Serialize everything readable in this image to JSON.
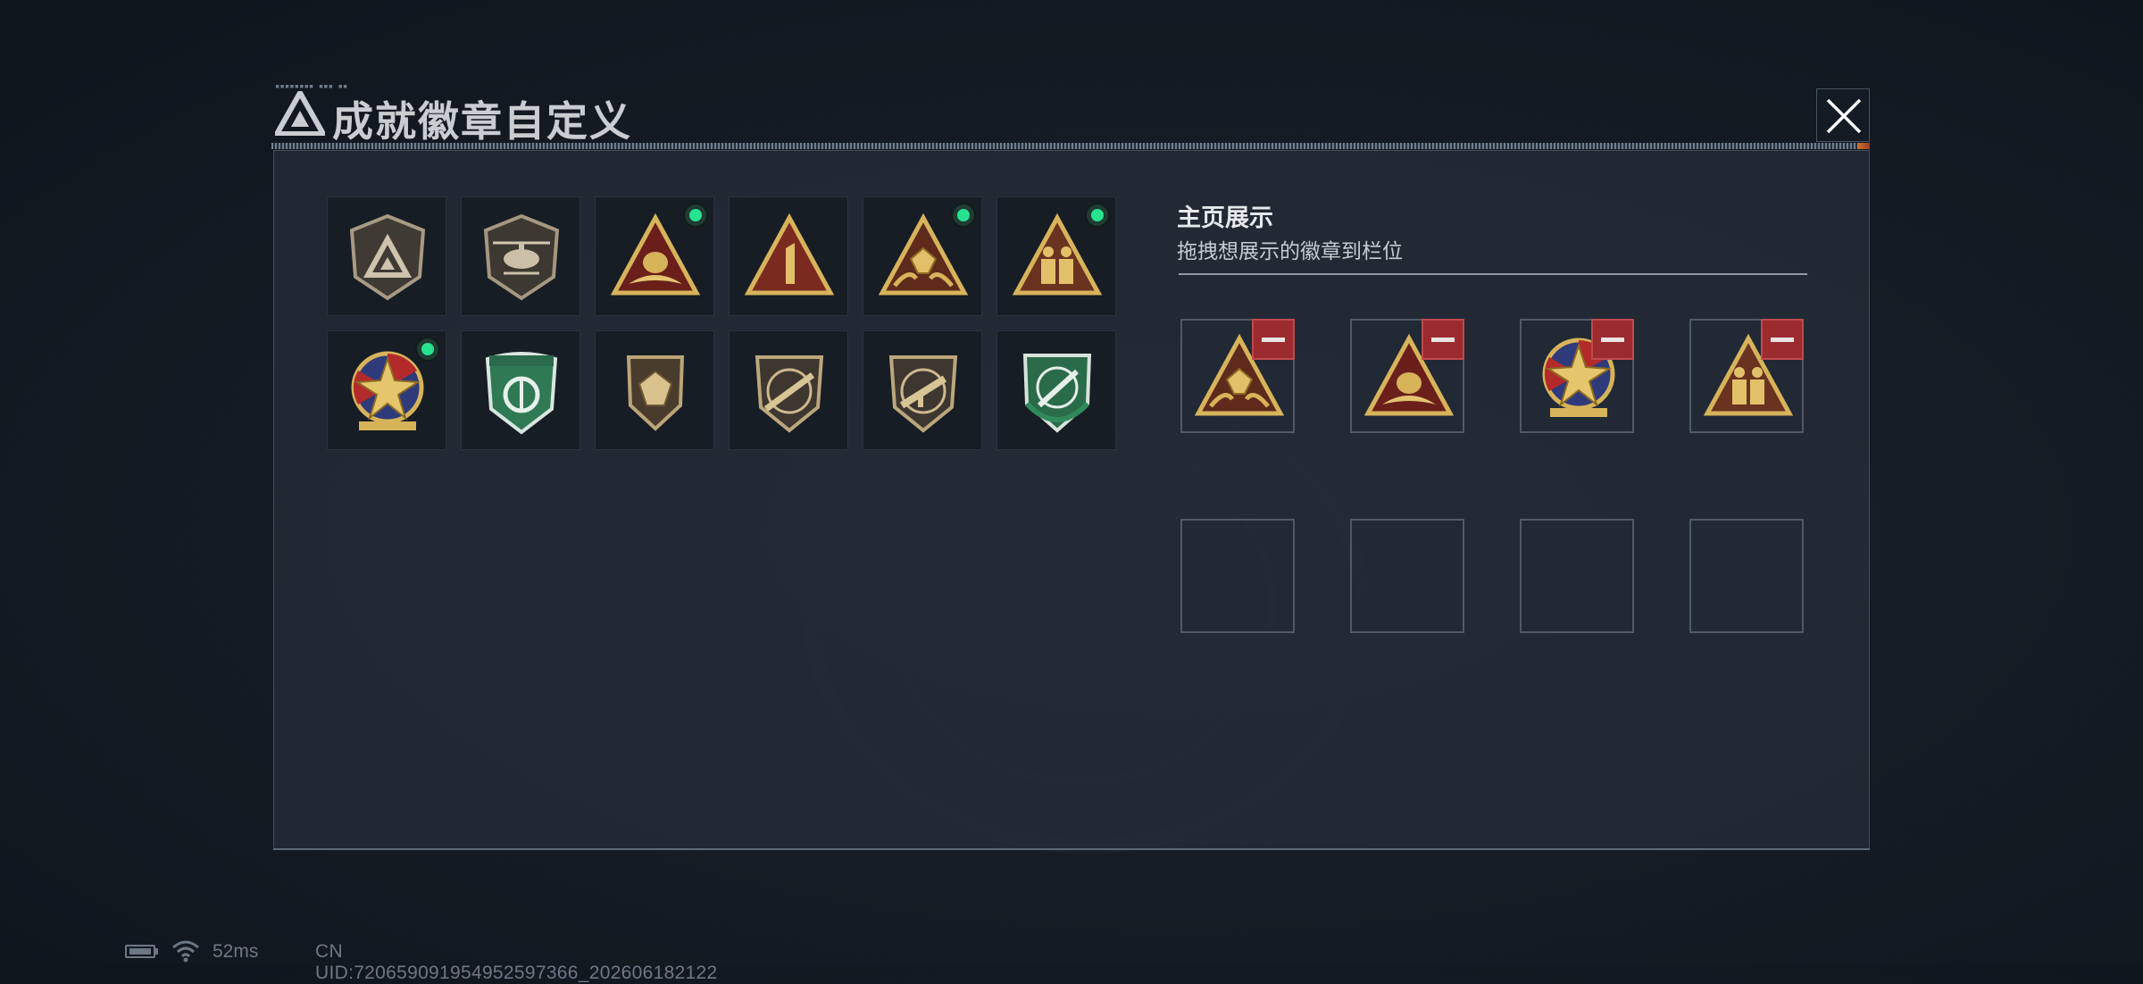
{
  "dialog": {
    "title": "成就徽章自定义",
    "close_icon": "close-icon"
  },
  "badges": [
    {
      "icon": "tactical-shield-badge",
      "new": false
    },
    {
      "icon": "helicopter-badge",
      "new": false
    },
    {
      "icon": "gold-triangle-eagle-badge",
      "new": true
    },
    {
      "icon": "number-one-triangle-badge",
      "new": false
    },
    {
      "icon": "gold-triangle-gem-badge",
      "new": true
    },
    {
      "icon": "gold-triangle-soldiers-badge",
      "new": true
    },
    {
      "icon": "star-medal-badge",
      "new": true
    },
    {
      "icon": "green-shield-badge",
      "new": false
    },
    {
      "icon": "bronze-gem-shield-badge",
      "new": false
    },
    {
      "icon": "bronze-rifle-shield-badge",
      "new": false
    },
    {
      "icon": "bronze-smg-shield-badge",
      "new": false
    },
    {
      "icon": "green-knife-shield-badge",
      "new": false
    }
  ],
  "showcase": {
    "title": "主页展示",
    "subtitle": "拖拽想展示的徽章到栏位",
    "slots": [
      {
        "icon": "gold-triangle-gem-badge",
        "filled": true
      },
      {
        "icon": "gold-triangle-eagle-badge",
        "filled": true
      },
      {
        "icon": "star-medal-badge",
        "filled": true
      },
      {
        "icon": "gold-triangle-soldiers-badge",
        "filled": true
      },
      {
        "icon": "",
        "filled": false
      },
      {
        "icon": "",
        "filled": false
      },
      {
        "icon": "",
        "filled": false
      },
      {
        "icon": "",
        "filled": false
      }
    ]
  },
  "status": {
    "ping": "52ms",
    "uid": "CN UID:720659091954952597366_202606182122"
  },
  "colors": {
    "accent_green": "#27e28f",
    "remove_red": "#9b2b2e",
    "gold": "#c8a24a"
  }
}
